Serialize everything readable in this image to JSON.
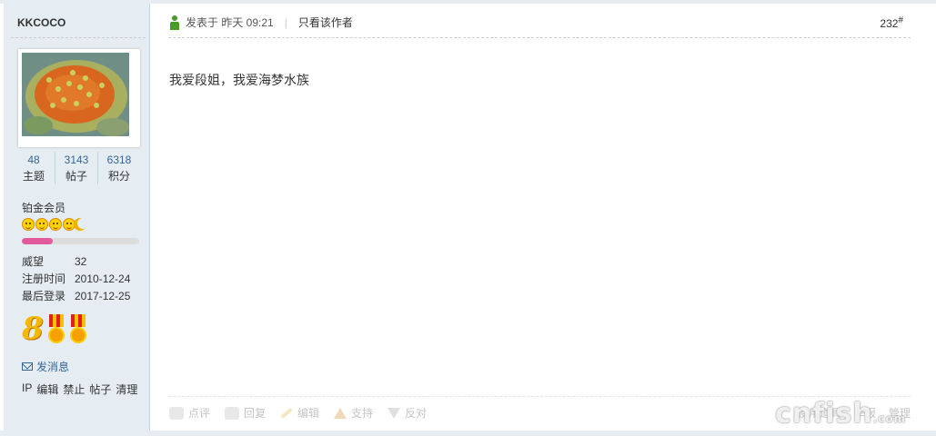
{
  "user": {
    "name": "KKCOCO",
    "stats": [
      {
        "value": "48",
        "label": "主题"
      },
      {
        "value": "3143",
        "label": "帖子"
      },
      {
        "value": "6318",
        "label": "积分"
      }
    ],
    "group": "铂金会员",
    "level_progress": 0.26,
    "info": [
      {
        "key": "威望",
        "value": "32"
      },
      {
        "key": "注册时间",
        "value": "2010-12-24"
      },
      {
        "key": "最后登录",
        "value": "2017-12-25"
      }
    ],
    "medal_text": "8",
    "send_message": "发消息",
    "admin_links": [
      "IP",
      "编辑",
      "禁止",
      "帖子",
      "清理"
    ]
  },
  "post": {
    "posted_at": "发表于 昨天 09:21",
    "only_author": "只看该作者",
    "floor": "232",
    "floor_mark": "#",
    "content": "我爱段姐，我爱海梦水族"
  },
  "actions": {
    "left": [
      "点评",
      "回复",
      "编辑",
      "支持",
      "反对"
    ],
    "right": [
      "使用道具",
      "举报",
      "管理"
    ]
  },
  "watermark": {
    "main": "cnfish",
    "sub": ".com"
  }
}
